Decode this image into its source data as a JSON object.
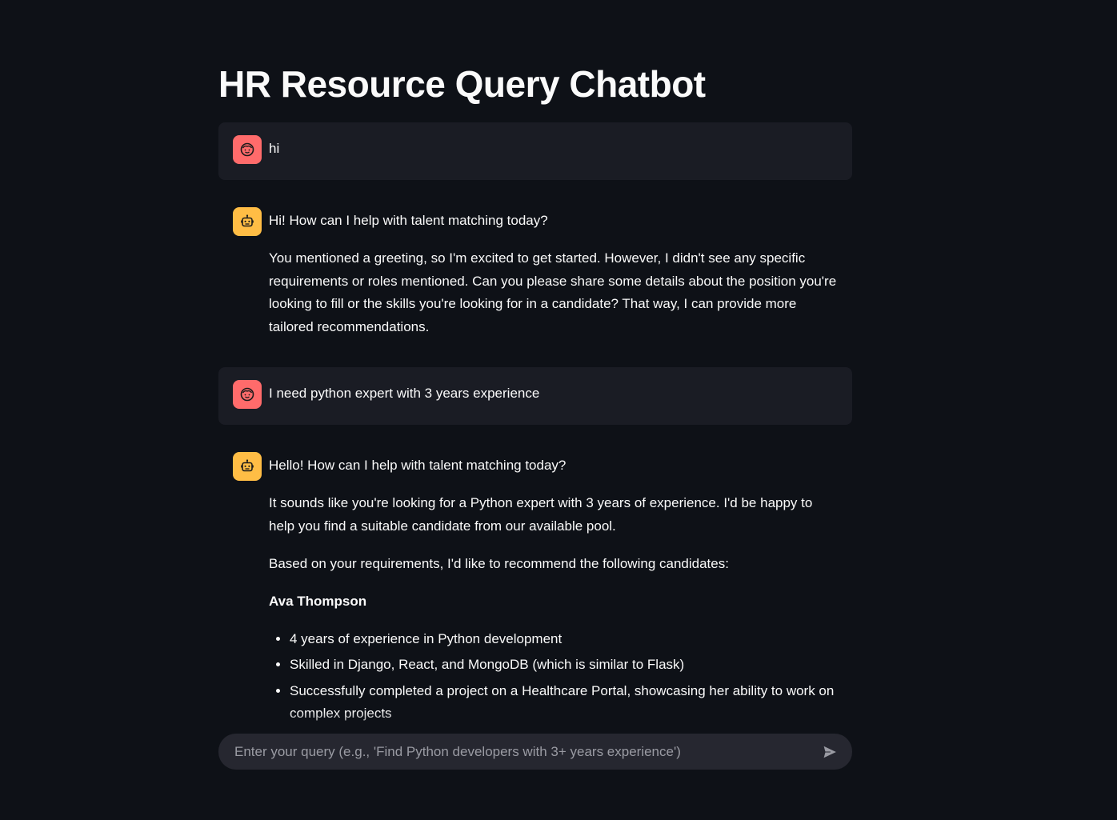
{
  "page": {
    "title": "HR Resource Query Chatbot"
  },
  "messages": [
    {
      "role": "user",
      "text": "hi"
    },
    {
      "role": "assistant",
      "paragraphs": [
        "Hi! How can I help with talent matching today?",
        "You mentioned a greeting, so I'm excited to get started. However, I didn't see any specific requirements or roles mentioned. Can you please share some details about the position you're looking to fill or the skills you're looking for in a candidate? That way, I can provide more tailored recommendations."
      ]
    },
    {
      "role": "user",
      "text": "I need python expert with 3 years experience"
    },
    {
      "role": "assistant",
      "paragraphs": [
        "Hello! How can I help with talent matching today?",
        "It sounds like you're looking for a Python expert with 3 years of experience. I'd be happy to help you find a suitable candidate from our available pool.",
        "Based on your requirements, I'd like to recommend the following candidates:"
      ],
      "candidate_name": "Ava Thompson",
      "bullets": [
        "4 years of experience in Python development",
        "Skilled in Django, React, and MongoDB (which is similar to Flask)",
        "Successfully completed a project on a Healthcare Portal, showcasing her ability to work on complex projects"
      ]
    }
  ],
  "chat_input": {
    "placeholder": "Enter your query (e.g., 'Find Python developers with 3+ years experience')",
    "value": ""
  },
  "icons": {
    "user_avatar": "face-icon",
    "assistant_avatar": "robot-icon",
    "send": "send-icon"
  },
  "colors": {
    "background": "#0e1117",
    "user_message_bg": "#1a1c24",
    "user_avatar": "#ff6b6b",
    "assistant_avatar": "#ffbd45",
    "input_bg": "#262730"
  }
}
